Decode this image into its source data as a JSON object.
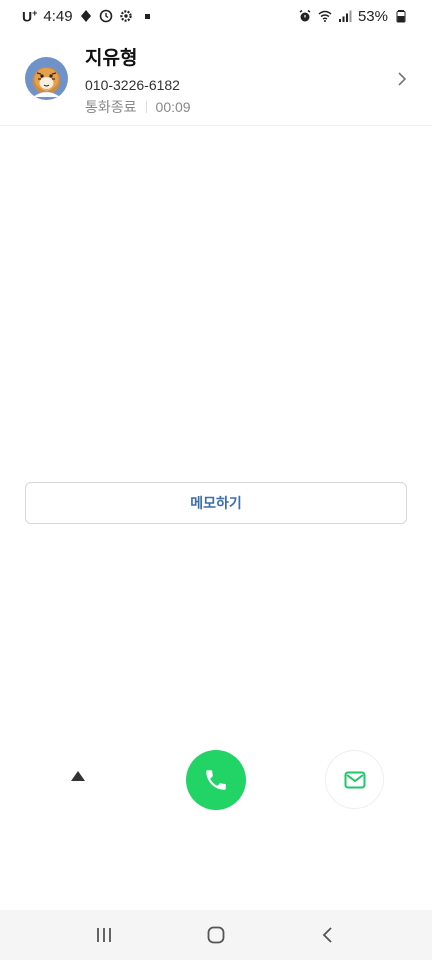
{
  "status_bar": {
    "carrier": "U",
    "carrier_sup": "+",
    "time": "4:49",
    "battery": "53%",
    "icons": [
      "navigation-icon",
      "clock-icon",
      "settings-icon",
      "alarm-icon",
      "wifi-icon",
      "signal-icon",
      "battery-icon"
    ]
  },
  "contact": {
    "name": "지유형",
    "phone": "010-3226-6182",
    "call_status": "통화종료",
    "duration": "00:09"
  },
  "memo": {
    "label": "메모하기"
  },
  "actions": {
    "expand_icon": "triangle-up-icon",
    "call_icon": "phone-icon",
    "message_icon": "envelope-icon",
    "call_color": "#22d466",
    "message_color": "#1ec76a"
  },
  "nav": {
    "icons": [
      "recent-apps-icon",
      "home-icon",
      "back-icon"
    ]
  },
  "colors": {
    "accent_text": "#3d6fa8",
    "muted_text": "#888888"
  }
}
